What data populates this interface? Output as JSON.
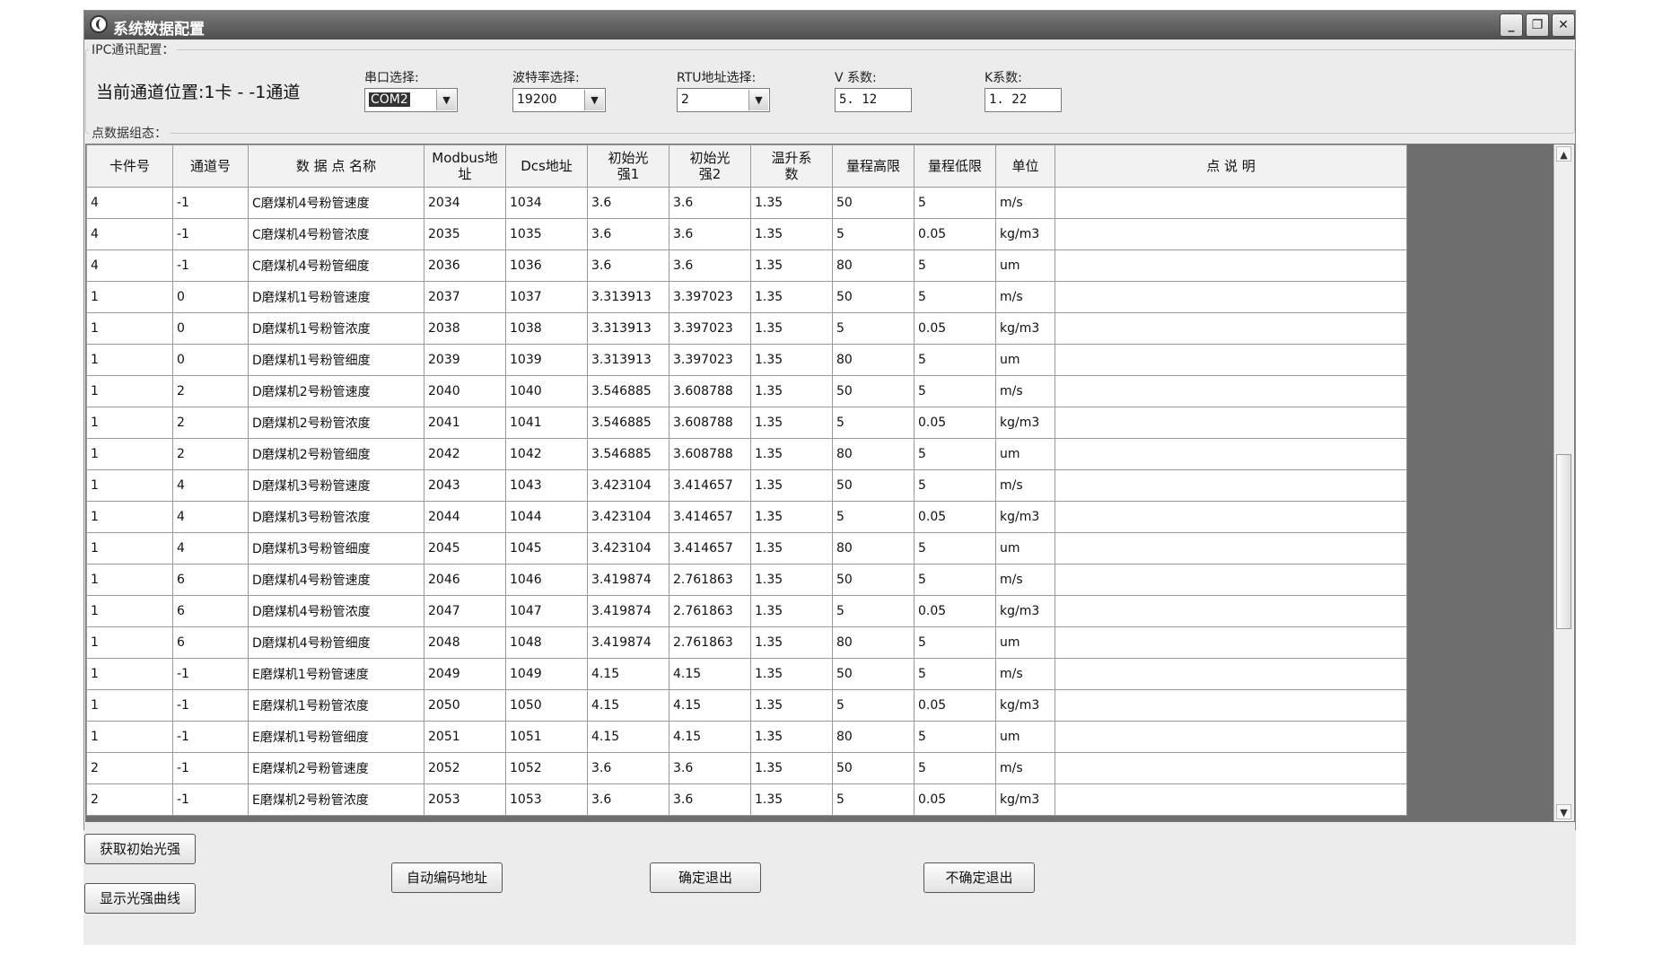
{
  "window": {
    "title": "系统数据配置",
    "minimize_glyph": "_",
    "restore_glyph": "❐",
    "close_glyph": "✕"
  },
  "ipc": {
    "group_label": "IPC通讯配置：",
    "current_channel": "当前通道位置:1卡 - -1通道",
    "serial_label": "串口选择:",
    "serial_value": "COM2",
    "baud_label": "波特率选择:",
    "baud_value": "19200",
    "rtu_label": "RTU地址选择:",
    "rtu_value": "2",
    "v_label": "V 系数:",
    "v_value": "5. 12",
    "k_label": "K系数:",
    "k_value": "1. 22",
    "dropdown_glyph": "▼"
  },
  "points": {
    "group_label": "点数据组态：",
    "columns": [
      "卡件号",
      "通道号",
      "数 据 点 名称",
      "Modbus地\n址",
      "Dcs地址",
      "初始光\n强1",
      "初始光\n强2",
      "温升系\n数",
      "量程高限",
      "量程低限",
      "单位",
      "点 说 明"
    ],
    "rows": [
      [
        "4",
        "-1",
        "C磨煤机4号粉管速度",
        "2034",
        "1034",
        "3.6",
        "3.6",
        "1.35",
        "50",
        "5",
        "m/s",
        ""
      ],
      [
        "4",
        "-1",
        "C磨煤机4号粉管浓度",
        "2035",
        "1035",
        "3.6",
        "3.6",
        "1.35",
        "5",
        "0.05",
        "kg/m3",
        ""
      ],
      [
        "4",
        "-1",
        "C磨煤机4号粉管细度",
        "2036",
        "1036",
        "3.6",
        "3.6",
        "1.35",
        "80",
        "5",
        "um",
        ""
      ],
      [
        "1",
        "0",
        "D磨煤机1号粉管速度",
        "2037",
        "1037",
        "3.313913",
        "3.397023",
        "1.35",
        "50",
        "5",
        "m/s",
        ""
      ],
      [
        "1",
        "0",
        "D磨煤机1号粉管浓度",
        "2038",
        "1038",
        "3.313913",
        "3.397023",
        "1.35",
        "5",
        "0.05",
        "kg/m3",
        ""
      ],
      [
        "1",
        "0",
        "D磨煤机1号粉管细度",
        "2039",
        "1039",
        "3.313913",
        "3.397023",
        "1.35",
        "80",
        "5",
        "um",
        ""
      ],
      [
        "1",
        "2",
        "D磨煤机2号粉管速度",
        "2040",
        "1040",
        "3.546885",
        "3.608788",
        "1.35",
        "50",
        "5",
        "m/s",
        ""
      ],
      [
        "1",
        "2",
        "D磨煤机2号粉管浓度",
        "2041",
        "1041",
        "3.546885",
        "3.608788",
        "1.35",
        "5",
        "0.05",
        "kg/m3",
        ""
      ],
      [
        "1",
        "2",
        "D磨煤机2号粉管细度",
        "2042",
        "1042",
        "3.546885",
        "3.608788",
        "1.35",
        "80",
        "5",
        "um",
        ""
      ],
      [
        "1",
        "4",
        "D磨煤机3号粉管速度",
        "2043",
        "1043",
        "3.423104",
        "3.414657",
        "1.35",
        "50",
        "5",
        "m/s",
        ""
      ],
      [
        "1",
        "4",
        "D磨煤机3号粉管浓度",
        "2044",
        "1044",
        "3.423104",
        "3.414657",
        "1.35",
        "5",
        "0.05",
        "kg/m3",
        ""
      ],
      [
        "1",
        "4",
        "D磨煤机3号粉管细度",
        "2045",
        "1045",
        "3.423104",
        "3.414657",
        "1.35",
        "80",
        "5",
        "um",
        ""
      ],
      [
        "1",
        "6",
        "D磨煤机4号粉管速度",
        "2046",
        "1046",
        "3.419874",
        "2.761863",
        "1.35",
        "50",
        "5",
        "m/s",
        ""
      ],
      [
        "1",
        "6",
        "D磨煤机4号粉管浓度",
        "2047",
        "1047",
        "3.419874",
        "2.761863",
        "1.35",
        "5",
        "0.05",
        "kg/m3",
        ""
      ],
      [
        "1",
        "6",
        "D磨煤机4号粉管细度",
        "2048",
        "1048",
        "3.419874",
        "2.761863",
        "1.35",
        "80",
        "5",
        "um",
        ""
      ],
      [
        "1",
        "-1",
        "E磨煤机1号粉管速度",
        "2049",
        "1049",
        "4.15",
        "4.15",
        "1.35",
        "50",
        "5",
        "m/s",
        ""
      ],
      [
        "1",
        "-1",
        "E磨煤机1号粉管浓度",
        "2050",
        "1050",
        "4.15",
        "4.15",
        "1.35",
        "5",
        "0.05",
        "kg/m3",
        ""
      ],
      [
        "1",
        "-1",
        "E磨煤机1号粉管细度",
        "2051",
        "1051",
        "4.15",
        "4.15",
        "1.35",
        "80",
        "5",
        "um",
        ""
      ],
      [
        "2",
        "-1",
        "E磨煤机2号粉管速度",
        "2052",
        "1052",
        "3.6",
        "3.6",
        "1.35",
        "50",
        "5",
        "m/s",
        ""
      ],
      [
        "2",
        "-1",
        "E磨煤机2号粉管浓度",
        "2053",
        "1053",
        "3.6",
        "3.6",
        "1.35",
        "5",
        "0.05",
        "kg/m3",
        ""
      ]
    ],
    "scroll_up_glyph": "▲",
    "scroll_down_glyph": "▼"
  },
  "buttons": {
    "get_initial_light": "获取初始光强",
    "show_light_curve": "显示光强曲线",
    "auto_encode_address": "自动编码地址",
    "confirm_exit": "确定退出",
    "cancel_exit": "不确定退出"
  }
}
